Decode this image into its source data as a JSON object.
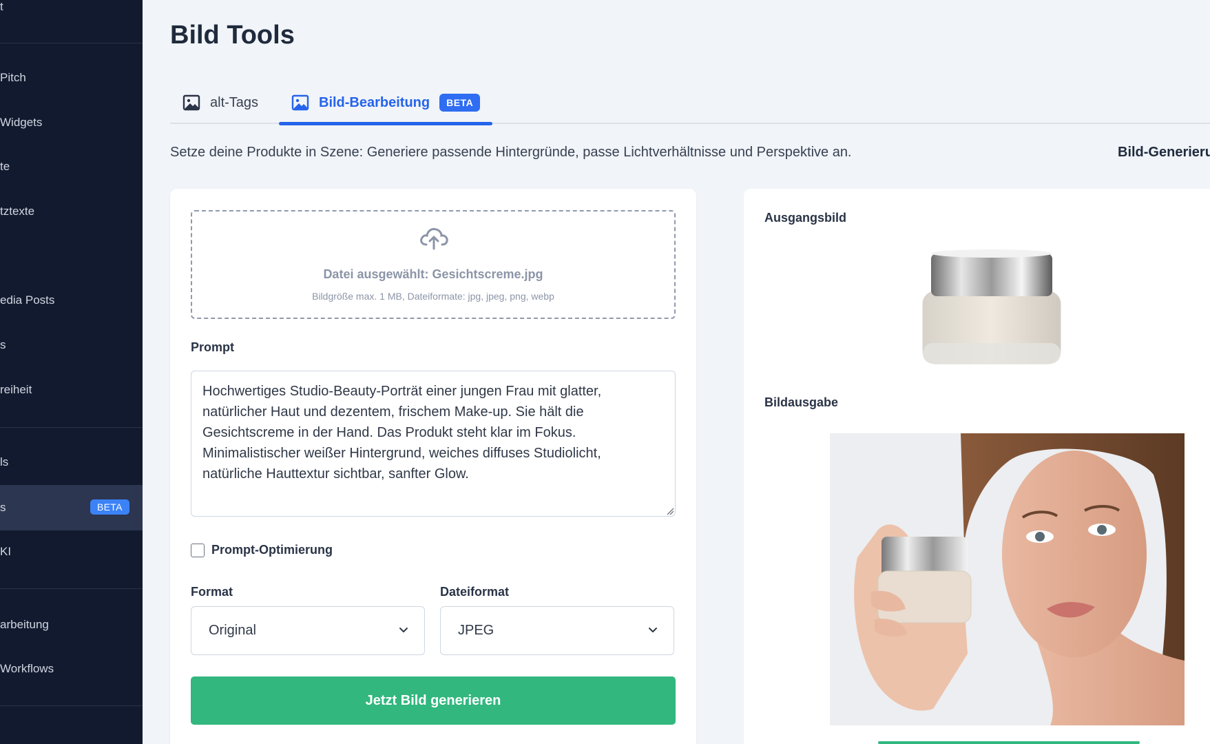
{
  "sidebar": {
    "items": [
      {
        "label": "t"
      },
      {
        "label": "Pitch"
      },
      {
        "label": "Widgets"
      },
      {
        "label": "te"
      },
      {
        "label": "tztexte"
      },
      {
        "label": "edia Posts"
      },
      {
        "label": "s"
      },
      {
        "label": "reiheit"
      },
      {
        "label": "ls"
      },
      {
        "label": "s",
        "badge": "BETA"
      },
      {
        "label": "KI"
      },
      {
        "label": "arbeitung"
      },
      {
        "label": "Workflows"
      }
    ]
  },
  "page": {
    "title": "Bild Tools",
    "tabs": [
      {
        "label": "alt-Tags"
      },
      {
        "label": "Bild-Bearbeitung",
        "badge": "BETA"
      }
    ],
    "intro": "Setze deine Produkte in Szene: Generiere passende Hintergründe, passe Lichtverhältnisse und Perspektive an.",
    "right_heading": "Bild-Generieru"
  },
  "upload": {
    "file_text": "Datei ausgewählt: Gesichtscreme.jpg",
    "hint": "Bildgröße max. 1 MB, Dateiformate: jpg, jpeg, png, webp"
  },
  "form": {
    "prompt_label": "Prompt",
    "prompt_value": "Hochwertiges Studio-Beauty-Porträt einer jungen Frau mit glatter, natürlicher Haut und dezentem, frischem Make-up. Sie hält die Gesichtscreme in der Hand. Das Produkt steht klar im Fokus. Minimalistischer weißer Hintergrund, weiches diffuses Studiolicht, natürliche Hauttextur sichtbar, sanfter Glow.",
    "optimize_label": "Prompt-Optimierung",
    "format_label": "Format",
    "format_value": "Original",
    "fileformat_label": "Dateiformat",
    "fileformat_value": "JPEG",
    "generate_label": "Jetzt Bild generieren"
  },
  "preview": {
    "source_label": "Ausgangsbild",
    "output_label": "Bildausgabe"
  },
  "colors": {
    "sidebar_bg": "#121a2f",
    "accent_blue": "#2563eb",
    "generate_green": "#32b77f"
  }
}
